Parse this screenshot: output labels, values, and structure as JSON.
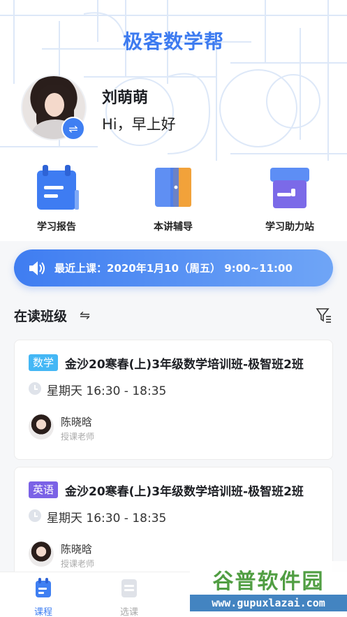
{
  "app": {
    "title": "极客数学帮"
  },
  "user": {
    "name": "刘萌萌",
    "greeting": "Hi，早上好"
  },
  "quick_links": [
    {
      "label": "学习报告",
      "icon": "calendar-report-icon"
    },
    {
      "label": "本讲辅导",
      "icon": "door-book-icon"
    },
    {
      "label": "学习助力站",
      "icon": "store-icon"
    }
  ],
  "recent_class": {
    "label": "最近上课：2020年1月10（周五） 9:00~11:00"
  },
  "section": {
    "title": "在读班级"
  },
  "classes": [
    {
      "tag": "数学",
      "tag_color": "#44b7f5",
      "course": "金沙20寒春(上)3年级数学培训班-极智班2班",
      "time": "星期天  16:30 - 18:35",
      "teacher": "陈晓晗",
      "role": "授课老师"
    },
    {
      "tag": "英语",
      "tag_color": "#7b62e6",
      "course": "金沙20寒春(上)3年级数学培训班-极智班2班",
      "time": "星期天  16:30 - 18:35",
      "teacher": "陈晓晗",
      "role": "授课老师"
    }
  ],
  "tabbar": [
    {
      "label": "课程",
      "active": true
    },
    {
      "label": "选课",
      "active": false
    }
  ],
  "watermark": {
    "main": "谷普软件园",
    "sub": "www.gupuxlazai.com"
  },
  "colors": {
    "accent": "#3f7ff2",
    "gradient_end": "#6fa5f6"
  }
}
